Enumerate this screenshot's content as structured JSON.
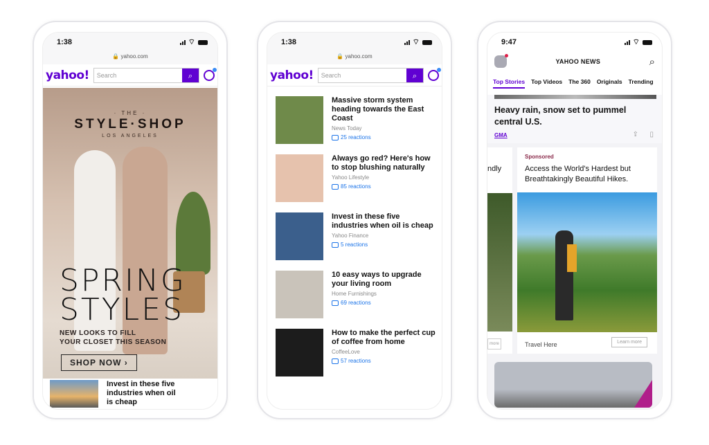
{
  "phone1": {
    "time": "1:38",
    "url": "yahoo.com",
    "logo": "yahoo!",
    "search_placeholder": "Search",
    "ad": {
      "brand_the": "· THE ·",
      "brand": "STYLE·SHOP",
      "brand_city": "LOS ANGELES",
      "headline_1": "SPRING",
      "headline_2": "STYLES",
      "subline_1": "NEW LOOKS TO FILL",
      "subline_2": "YOUR CLOSET THIS SEASON",
      "cta": "SHOP NOW ›"
    },
    "article": "Invest in these five industries when oil is cheap"
  },
  "phone2": {
    "time": "1:38",
    "url": "yahoo.com",
    "logo": "yahoo!",
    "search_placeholder": "Search",
    "articles": [
      {
        "title": "Massive storm system heading towards the East Coast",
        "source": "News Today",
        "reactions": "25 reactions",
        "thumb_color": "#6f8a4a"
      },
      {
        "title": "Always go red? Here's how to stop blushing naturally",
        "source": "Yahoo Lifestyle",
        "reactions": "85 reactions",
        "thumb_color": "#e6c2ad"
      },
      {
        "title": "Invest in these five industries when oil is cheap",
        "source": "Yahoo Finance",
        "reactions": "5 reactions",
        "thumb_color": "#3b5f8c"
      },
      {
        "title": "10 easy ways to upgrade your living room",
        "source": "Home Furnishings",
        "reactions": "69 reactions",
        "thumb_color": "#c9c3ba"
      },
      {
        "title": "How to make the perfect cup of coffee from home",
        "source": "CoffeeLove",
        "reactions": "57 reactions",
        "thumb_color": "#1c1c1c"
      }
    ]
  },
  "phone3": {
    "time": "9:47",
    "title": "YAHOO NEWS",
    "tabs": [
      "Top Stories",
      "Top Videos",
      "The 360",
      "Originals",
      "Trending"
    ],
    "headline": "Heavy rain, snow set to pummel central U.S.",
    "headline_source": "GMA",
    "partial_card_text": "ndly",
    "partial_card_button": "more",
    "sponsored_label": "Sponsored",
    "ad_title": "Access the World's Hardest but Breathtakingly Beautiful Hikes.",
    "ad_footer": "Travel Here",
    "ad_cta": "Learn more"
  },
  "colors": {
    "brand": "#6001d2",
    "link": "#1a73e8"
  }
}
